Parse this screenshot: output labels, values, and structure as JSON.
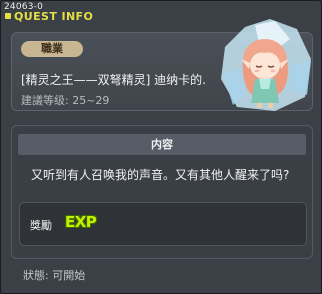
{
  "window": {
    "id": "24063-0",
    "title": "QUEST INFO"
  },
  "header": {
    "job_badge": "職業",
    "quest_name": "[精灵之王——双弩精灵] 迪纳卡的.",
    "level_label": "建議等级: 25~29"
  },
  "content": {
    "header": "内容",
    "text": "又听到有人召唤我的声音。又有其他人醒来了吗?",
    "reward_label": "獎勵",
    "reward_icon": "EXP"
  },
  "status": "狀態: 可開始",
  "colors": {
    "title": "#e6de45",
    "exp": "#c6f000",
    "badge": "#c8b592"
  }
}
